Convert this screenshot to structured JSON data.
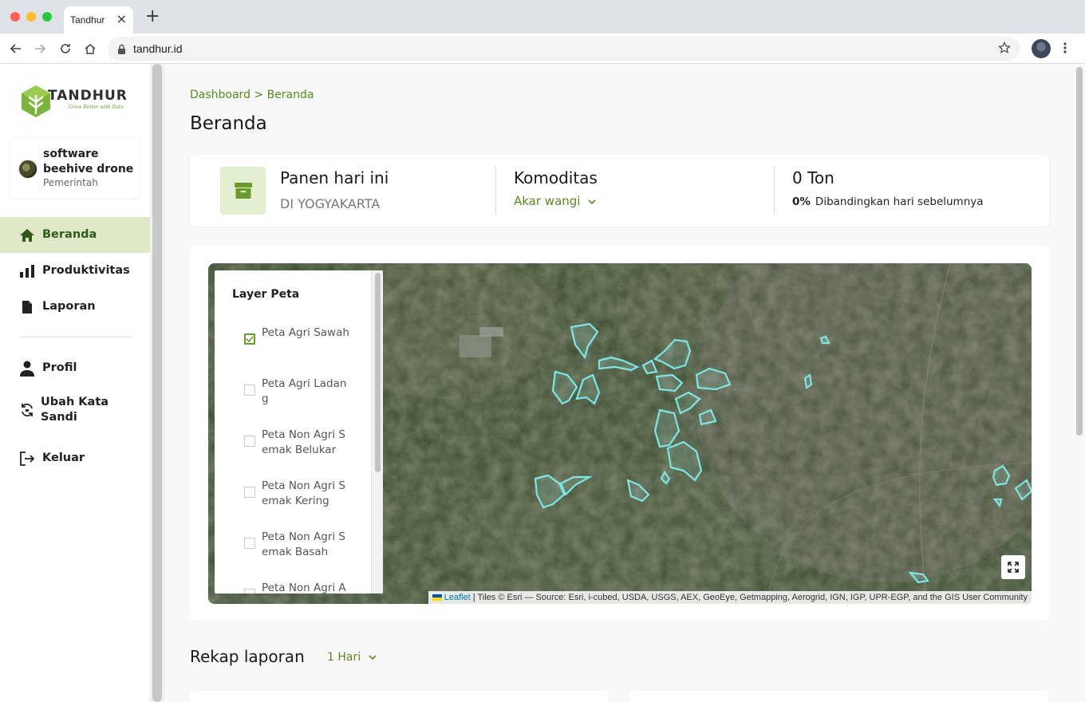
{
  "browser": {
    "tab_title": "Tandhur",
    "url": "tandhur.id"
  },
  "sidebar": {
    "logo_text": "TANDHUR",
    "logo_tagline": "Grow Better with Data",
    "user": {
      "name": "software beehive drone",
      "role": "Pemerintah"
    },
    "items": [
      {
        "label": "Beranda",
        "icon": "home-icon",
        "active": true
      },
      {
        "label": "Produktivitas",
        "icon": "bar-chart-icon",
        "active": false
      },
      {
        "label": "Laporan",
        "icon": "document-icon",
        "active": false
      },
      {
        "label": "Profil",
        "icon": "person-icon",
        "active": false
      },
      {
        "label": "Ubah Kata Sandi",
        "icon": "refresh-lock-icon",
        "active": false
      },
      {
        "label": "Keluar",
        "icon": "logout-icon",
        "active": false
      }
    ]
  },
  "main": {
    "breadcrumb": "Dashboard > Beranda",
    "title": "Beranda",
    "stats": {
      "harvest_title": "Panen hari ini",
      "harvest_region": "DI YOGYAKARTA",
      "commodity_title": "Komoditas",
      "commodity_value": "Akar wangi",
      "amount": "0 Ton",
      "change_percent": "0%",
      "change_text": "Dibandingkan hari sebelumnya"
    },
    "map": {
      "layer_title": "Layer Peta",
      "layers": [
        {
          "label": "Peta Agri Sawah",
          "checked": true
        },
        {
          "label": "Peta Agri Ladang",
          "checked": false
        },
        {
          "label": "Peta Non Agri Semak Belukar",
          "checked": false
        },
        {
          "label": "Peta Non Agri Semak Kering",
          "checked": false
        },
        {
          "label": "Peta Non Agri Semak Basah",
          "checked": false
        },
        {
          "label": "Peta Non Agri A",
          "checked": false
        }
      ],
      "attribution_leaflet": "Leaflet",
      "attribution_text": " | Tiles © Esri — Source: Esri, i-cubed, USDA, USGS, AEX, GeoEye, Getmapping, Aerogrid, IGN, IGP, UPR-EGP, and the GIS User Community",
      "polygon_color": "#7fe6e6"
    },
    "recap": {
      "title": "Rekap laporan",
      "period": "1 Hari"
    }
  },
  "colors": {
    "accent_green": "#5a8a1f",
    "active_bg": "#dfe9c8"
  }
}
